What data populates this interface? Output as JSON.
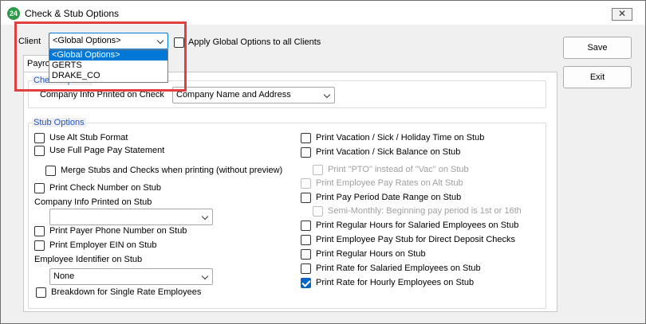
{
  "window": {
    "title": "Check & Stub Options",
    "app_icon_text": "24",
    "close_glyph": "✕"
  },
  "client": {
    "label": "Client",
    "selected": "<Global Options>",
    "options": [
      "<Global Options>",
      "GERTS",
      "DRAKE_CO"
    ],
    "apply_all_label": "Apply Global Options to all Clients"
  },
  "buttons": {
    "save": "Save",
    "exit": "Exit"
  },
  "tab": {
    "label": "Payroll"
  },
  "check_options": {
    "title": "Check Options",
    "company_info_label": "Company Info Printed on Check",
    "company_info_value": "Company Name and Address"
  },
  "stub_options": {
    "title": "Stub Options",
    "left": {
      "use_alt_stub": "Use Alt Stub Format",
      "use_full_page": "Use Full Page Pay Statement",
      "merge_stubs": "Merge Stubs and Checks when printing (without preview)",
      "print_check_number": "Print Check Number on Stub",
      "company_info_label": "Company Info Printed on Stub",
      "company_info_value": "",
      "print_payer_phone": "Print Payer Phone Number on Stub",
      "print_employer_ein": "Print Employer EIN on Stub",
      "employee_identifier_label": "Employee Identifier on Stub",
      "employee_identifier_value": "None",
      "breakdown_single_rate": "Breakdown for Single Rate Employees"
    },
    "right": {
      "print_vacation_time": "Print Vacation / Sick / Holiday Time on Stub",
      "print_vacation_balance": "Print Vacation / Sick Balance on Stub",
      "print_pto": "Print \"PTO\" instead of \"Vac\" on Stub",
      "print_pay_rates_alt": "Print Employee Pay Rates on Alt Stub",
      "print_pay_period": "Print Pay Period Date Range on Stub",
      "semi_monthly": "Semi-Monthly: Beginning pay period is 1st or 16th",
      "print_regular_salaried": "Print Regular Hours for Salaried Employees on Stub",
      "print_direct_deposit": "Print Employee Pay Stub for Direct Deposit Checks",
      "print_regular_hours": "Print Regular Hours on Stub",
      "print_rate_salaried": "Print Rate for Salaried Employees on Stub",
      "print_rate_hourly": "Print Rate for Hourly Employees on Stub"
    }
  },
  "colors": {
    "group_title": "#1c56c7",
    "checked_accent": "#0067c0",
    "highlight": "#e04040",
    "app_icon": "#2f9a4a"
  }
}
